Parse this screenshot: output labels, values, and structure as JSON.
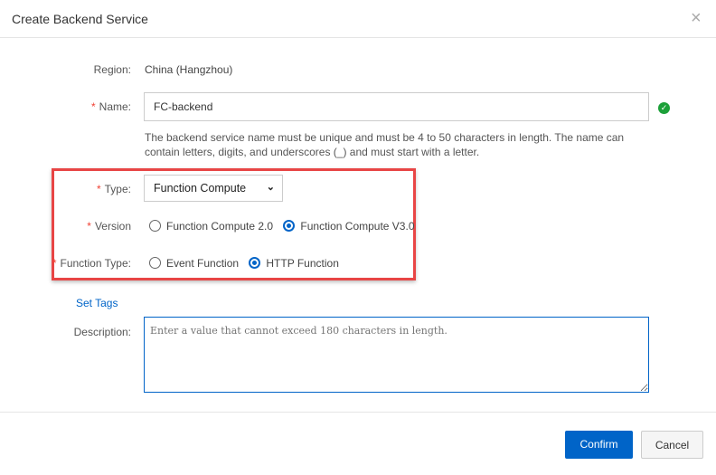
{
  "dialog": {
    "title": "Create Backend Service",
    "close_icon": "×"
  },
  "region": {
    "label": "Region:",
    "value": "China (Hangzhou)"
  },
  "name": {
    "label": "Name:",
    "value": "FC-backend",
    "help": "The backend service name must be unique and must be 4 to 50 characters in length. The name can contain letters, digits, and underscores (_) and must start with a letter."
  },
  "type": {
    "label": "Type:",
    "value": "Function Compute"
  },
  "version": {
    "label": "Version",
    "options": [
      "Function Compute 2.0",
      "Function Compute V3.0"
    ],
    "selected": 1
  },
  "function_type": {
    "label": "Function Type:",
    "options": [
      "Event Function",
      "HTTP Function"
    ],
    "selected": 1
  },
  "set_tags": "Set Tags",
  "description": {
    "label": "Description:",
    "placeholder": "Enter a value that cannot exceed 180 characters in length."
  },
  "footer": {
    "confirm": "Confirm",
    "cancel": "Cancel"
  },
  "colors": {
    "primary": "#0064c8",
    "highlight": "#e84545",
    "success": "#1ca039"
  }
}
